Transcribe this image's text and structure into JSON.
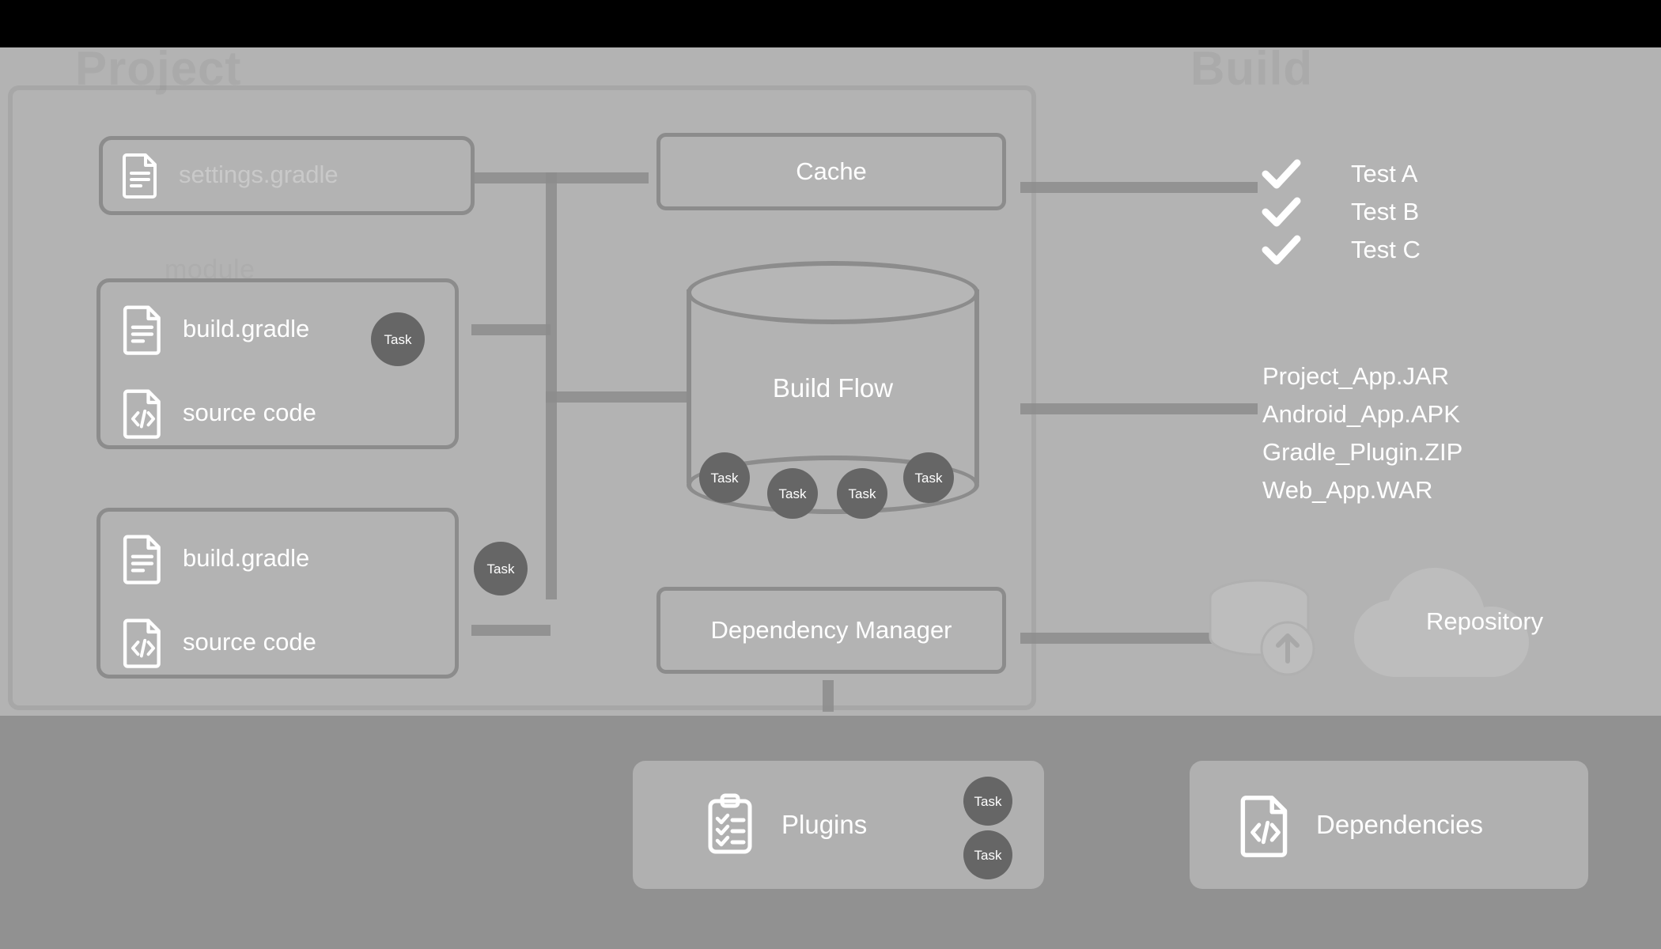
{
  "diagram": {
    "title": "Project",
    "subtitle_right": "Build",
    "section_label_module": "module",
    "settings_file": "settings.gradle",
    "modules": [
      {
        "build_file": "build.gradle",
        "source": "source code",
        "task_label": "Task"
      },
      {
        "build_file": "build.gradle",
        "source": "source code",
        "task_label": "Task"
      }
    ],
    "cache": {
      "label": "Cache"
    },
    "build_flow": {
      "label": "Build Flow",
      "tasks": [
        "Task",
        "Task",
        "Task",
        "Task"
      ]
    },
    "dependency_manager": {
      "label": "Dependency Manager"
    },
    "tests": [
      {
        "label": "Test A",
        "status": "passed"
      },
      {
        "label": "Test B",
        "status": "passed"
      },
      {
        "label": "Test C",
        "status": "passed"
      }
    ],
    "artifacts": [
      "Project_App.JAR",
      "Android_App.APK",
      "Gradle_Plugin.ZIP",
      "Web_App.WAR"
    ],
    "repository": {
      "label": "Repository"
    },
    "plugins": {
      "label": "Plugins",
      "tasks": [
        "Task",
        "Task"
      ]
    },
    "dependencies": {
      "label": "Dependencies"
    },
    "colors": {
      "background_top": "#000000",
      "panel_background": "#b3b3b3",
      "bottom_background": "#919191",
      "stroke": "#8c8c8c",
      "text_on_fill": "#ffffff",
      "task_fill": "#666666",
      "faint_text": "#aaaaaa"
    }
  }
}
